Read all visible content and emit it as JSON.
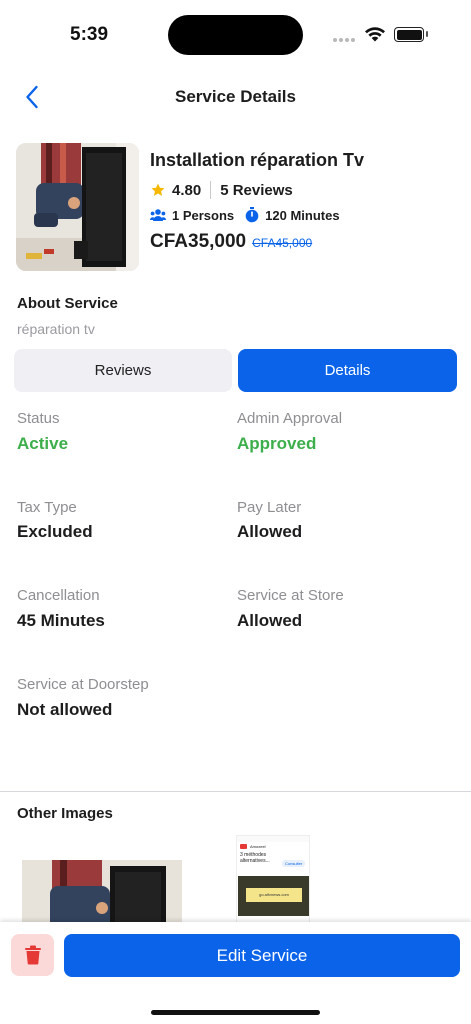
{
  "status_bar": {
    "time": "5:39"
  },
  "nav": {
    "title": "Service Details",
    "back_icon": "chevron-left-icon"
  },
  "service": {
    "name": "Installation réparation Tv",
    "rating": "4.80",
    "reviews": "5 Reviews",
    "persons": "1 Persons",
    "duration": "120 Minutes",
    "price": "CFA35,000",
    "old_price": "CFA45,000"
  },
  "about": {
    "title": "About Service",
    "text": "réparation tv"
  },
  "tabs": {
    "reviews": "Reviews",
    "details": "Details",
    "active": "Details"
  },
  "details": [
    {
      "label": "Status",
      "value": "Active",
      "highlight": true
    },
    {
      "label": "Admin Approval",
      "value": "Approved",
      "highlight": true
    },
    {
      "label": "Tax Type",
      "value": "Excluded",
      "highlight": false
    },
    {
      "label": "Pay Later",
      "value": "Allowed",
      "highlight": false
    },
    {
      "label": "Cancellation",
      "value": "45 Minutes",
      "highlight": false
    },
    {
      "label": "Service at Store",
      "value": "Allowed",
      "highlight": false
    },
    {
      "label": "Service at Doorstep",
      "value": "Not allowed",
      "highlight": false
    }
  ],
  "other_images": {
    "title": "Other Images",
    "thumb2": {
      "title": "Amoxeel",
      "line": "3 méthodes alternatives...",
      "button": "Consulter",
      "screen": "go.alfvnews.com"
    }
  },
  "actions": {
    "edit": "Edit Service",
    "delete_icon": "trash-icon"
  },
  "colors": {
    "primary": "#0a63e9",
    "success": "#3cae4b",
    "danger_bg": "#fbd9d9",
    "danger": "#e53935",
    "star": "#f6b800"
  }
}
